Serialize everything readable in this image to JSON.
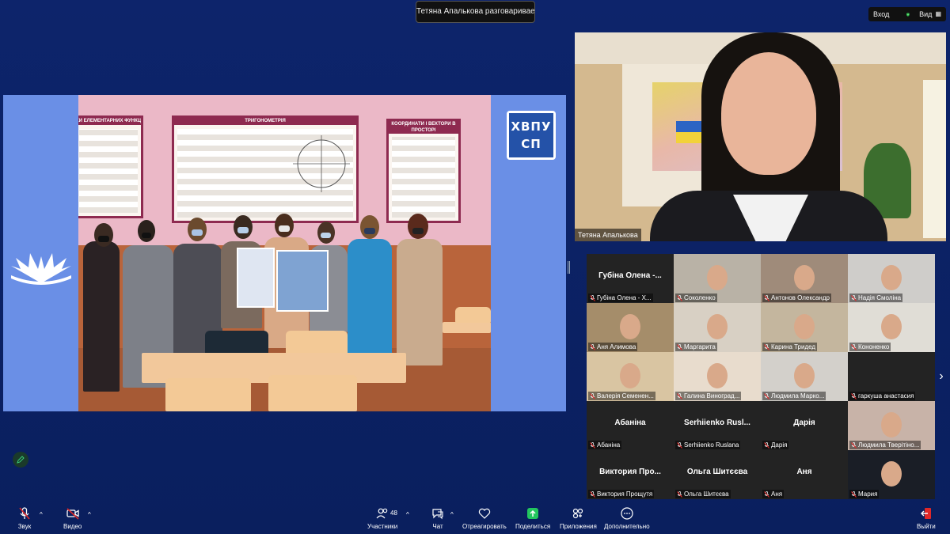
{
  "speaking_indicator": "Тетяна Апалькова разговаривает...",
  "view_bar": {
    "enter_label": "Вход",
    "view_label": "Вид"
  },
  "shared_screen": {
    "logo_text_line1": "ХВПУ",
    "logo_text_line2": "СП",
    "poster_titles": [
      "КИ ЕЛЕМЕНТАРНИХ ФУНКЦІЙ",
      "ТРИГОНОМЕТРІЯ",
      "КООРДИНАТИ І ВЕКТОРИ В ПРОСТОРІ"
    ]
  },
  "speaker": {
    "name": "Тетяна Апалькова"
  },
  "gallery": {
    "tiles": [
      {
        "label": "Губіна Олена - Х...",
        "big_name": "Губіна Олена -...",
        "video": false
      },
      {
        "label": "Соколенко",
        "video": true,
        "bg": "#b9b2a6"
      },
      {
        "label": "Антонов Олександр",
        "video": true,
        "bg": "#9f8b7a"
      },
      {
        "label": "Надія Смоліна",
        "video": true,
        "bg": "#cfcdca"
      },
      {
        "label": "Аня Алимова",
        "video": true,
        "bg": "#a58d6a"
      },
      {
        "label": "Маргарита",
        "video": true,
        "bg": "#d8d0c4"
      },
      {
        "label": "Карина Тридед",
        "video": true,
        "bg": "#c4b69e"
      },
      {
        "label": "Кононенко",
        "video": true,
        "bg": "#e0ddd6"
      },
      {
        "label": "Валерія Семенен...",
        "video": true,
        "bg": "#d9c5a2"
      },
      {
        "label": "Галина Виноград...",
        "video": true,
        "bg": "#e8dccd"
      },
      {
        "label": "Людмила Марко...",
        "video": true,
        "bg": "#d3d0cb"
      },
      {
        "label": "гаркуша анастасия",
        "video": false,
        "big_name": ""
      },
      {
        "label": "Абаніна",
        "big_name": "Абаніна",
        "video": false
      },
      {
        "label": "Serhiienko Ruslana",
        "big_name": "Serhiienko Rusl...",
        "video": false
      },
      {
        "label": "Дарія",
        "big_name": "Дарія",
        "video": false
      },
      {
        "label": "Людмила Тверітіно...",
        "video": true,
        "bg": "#c8b3a8"
      },
      {
        "label": "Виктория Прощутя",
        "big_name": "Виктория Про...",
        "video": false
      },
      {
        "label": "Ольга Шитєєва",
        "big_name": "Ольга Шитєєва",
        "video": false
      },
      {
        "label": "Аня",
        "big_name": "Аня",
        "video": false
      },
      {
        "label": "Мария",
        "video": true,
        "bg": "#1a1e26"
      }
    ]
  },
  "toolbar": {
    "audio": "Звук",
    "video": "Видео",
    "participants": "Участники",
    "participants_count": "48",
    "chat": "Чат",
    "react": "Отреагировать",
    "share": "Поделиться",
    "apps": "Приложения",
    "more": "Дополнительно",
    "leave": "Выйти"
  },
  "colors": {
    "background": "#0d246b",
    "share_green": "#22c55e",
    "leave_red": "#e02828"
  }
}
